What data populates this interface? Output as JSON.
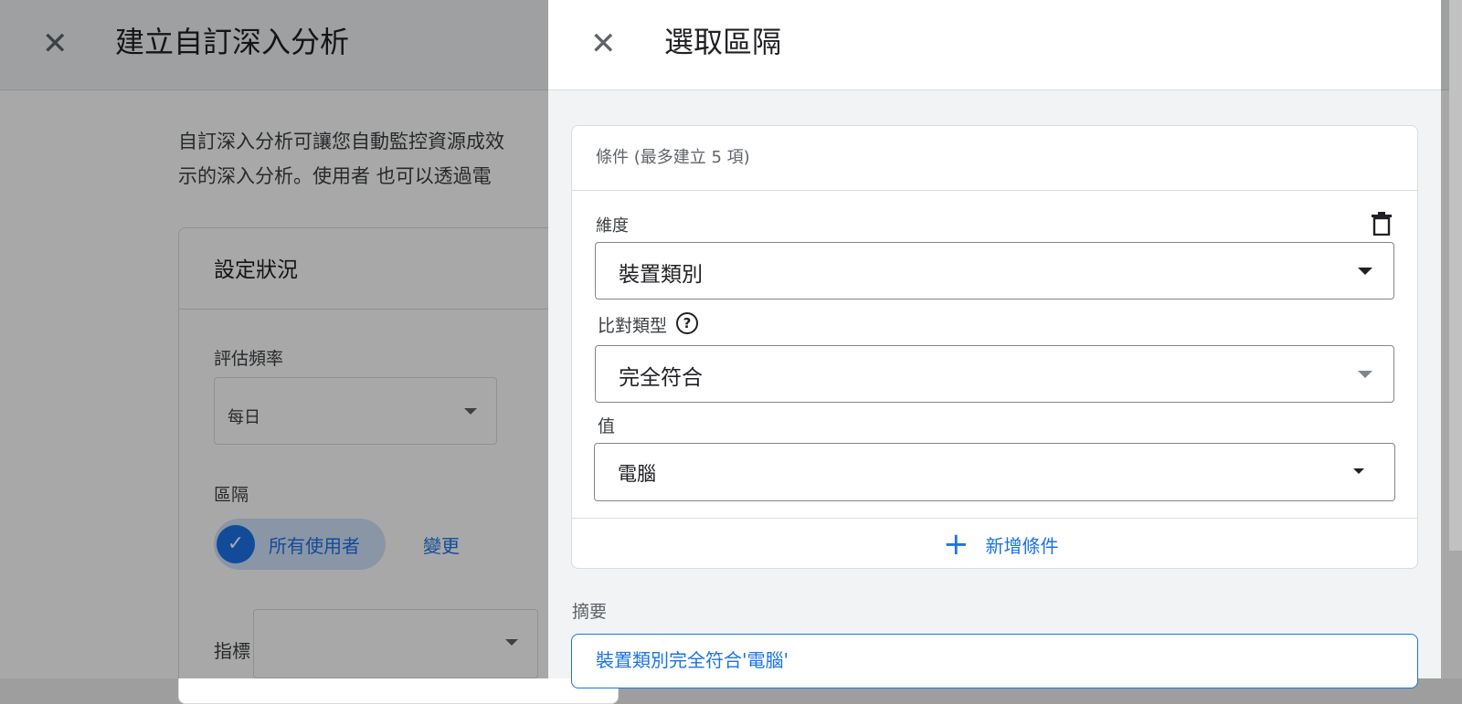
{
  "background": {
    "close_glyph": "✕",
    "title": "建立自訂深入分析",
    "description": "自訂深入分析可讓您自動監控資源成效\n示的深入分析。使用者 也可以透過電",
    "card_title": "設定狀況",
    "frequency_label": "評估頻率",
    "frequency_value": "每日",
    "segment_label": "區隔",
    "segment_chip": "所有使用者",
    "segment_change": "變更",
    "metric_label": "指標"
  },
  "panel": {
    "close_glyph": "✕",
    "title": "選取區隔",
    "conditions_title": "條件 (最多建立 5 項)",
    "dimension_label": "維度",
    "dimension_value": "裝置類別",
    "match_type_label": "比對類型",
    "help_glyph": "?",
    "match_type_value": "完全符合",
    "value_label": "值",
    "value_value": "電腦",
    "add_condition_icon": "+",
    "add_condition": "新增條件",
    "summary_label": "摘要",
    "summary_value": "裝置類別完全符合'電腦'"
  },
  "colors": {
    "accent": "#1a73e8",
    "scrim": "rgba(0,0,0,0.34)",
    "panel_bg": "#f1f3f4"
  },
  "icons": [
    "close-icon",
    "delete-icon",
    "help-icon",
    "check-icon",
    "add-icon",
    "dropdown-caret-icon"
  ]
}
